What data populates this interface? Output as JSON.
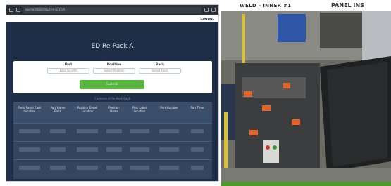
{
  "browser": {
    "url": "api/dashboard/ED-re-pack/A",
    "logout_label": "Logout"
  },
  "page": {
    "title": "ED Re-Pack A"
  },
  "form": {
    "part_label": "Part",
    "part_value": "1234567890",
    "position_label": "Position",
    "position_placeholder": "Select Position",
    "rack_label": "Rack",
    "rack_placeholder": "Select Rack",
    "submit_label": "Submit"
  },
  "count_text": "Contents of Re-Pack Rack",
  "table": {
    "headers": [
      "Front Panel Rack Location",
      "Part Name Rack",
      "Position Detail Location",
      "Position Name",
      "Part Label Location",
      "Part Number",
      "Part Time"
    ],
    "rows": [
      [
        "",
        "",
        "",
        "",
        "",
        "",
        ""
      ],
      [
        "",
        "",
        "",
        "",
        "",
        "",
        ""
      ],
      [
        "",
        "",
        "",
        "",
        "",
        "",
        ""
      ]
    ]
  },
  "camera": {
    "title": "WELD – INNER #1",
    "right_label": "PANEL INS"
  }
}
